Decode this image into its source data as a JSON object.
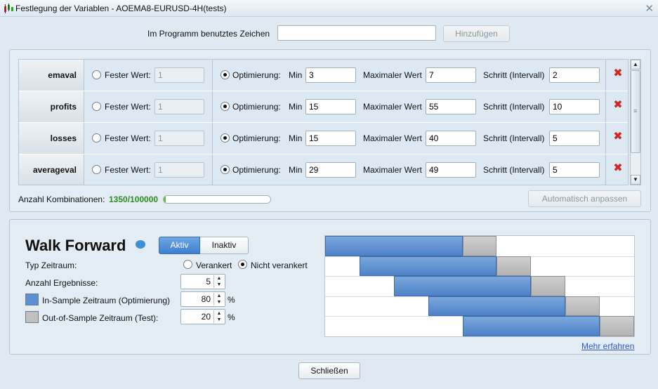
{
  "window": {
    "title": "Festlegung der Variablen - AOEMA8-EURUSD-4H(tests)"
  },
  "symbol": {
    "label": "Im Programm benutztes Zeichen",
    "value": "",
    "add_button": "Hinzufügen"
  },
  "variables": {
    "fixed_label": "Fester Wert:",
    "opt_label": "Optimierung:",
    "min_label": "Min",
    "max_label": "Maximaler Wert",
    "step_label": "Schritt (Intervall)",
    "rows": [
      {
        "name": "emaval",
        "fixed": "1",
        "min": "3",
        "max": "7",
        "step": "2"
      },
      {
        "name": "profits",
        "fixed": "1",
        "min": "15",
        "max": "55",
        "step": "10"
      },
      {
        "name": "losses",
        "fixed": "1",
        "min": "15",
        "max": "40",
        "step": "5"
      },
      {
        "name": "averageval",
        "fixed": "1",
        "min": "29",
        "max": "49",
        "step": "5"
      }
    ]
  },
  "combinations": {
    "label": "Anzahl Kombinationen:",
    "value": "1350/100000",
    "progress": 0.0135,
    "auto_button": "Automatisch anpassen"
  },
  "walk_forward": {
    "title": "Walk Forward",
    "active": "Aktiv",
    "inactive": "Inaktiv",
    "period_label": "Typ Zeitraum:",
    "anchored": "Verankert",
    "not_anchored": "Nicht verankert",
    "results_label": "Anzahl Ergebnisse:",
    "results": "5",
    "in_sample_label": "In-Sample Zeitraum (Optimierung)",
    "in_sample": "80",
    "out_sample_label": "Out-of-Sample Zeitraum (Test):",
    "out_sample": "20",
    "percent": "%",
    "more_link": "Mehr erfahren",
    "colors": {
      "in_sample": "#5b8fd2",
      "out_sample": "#c0c0c0"
    }
  },
  "close_button": "Schließen"
}
